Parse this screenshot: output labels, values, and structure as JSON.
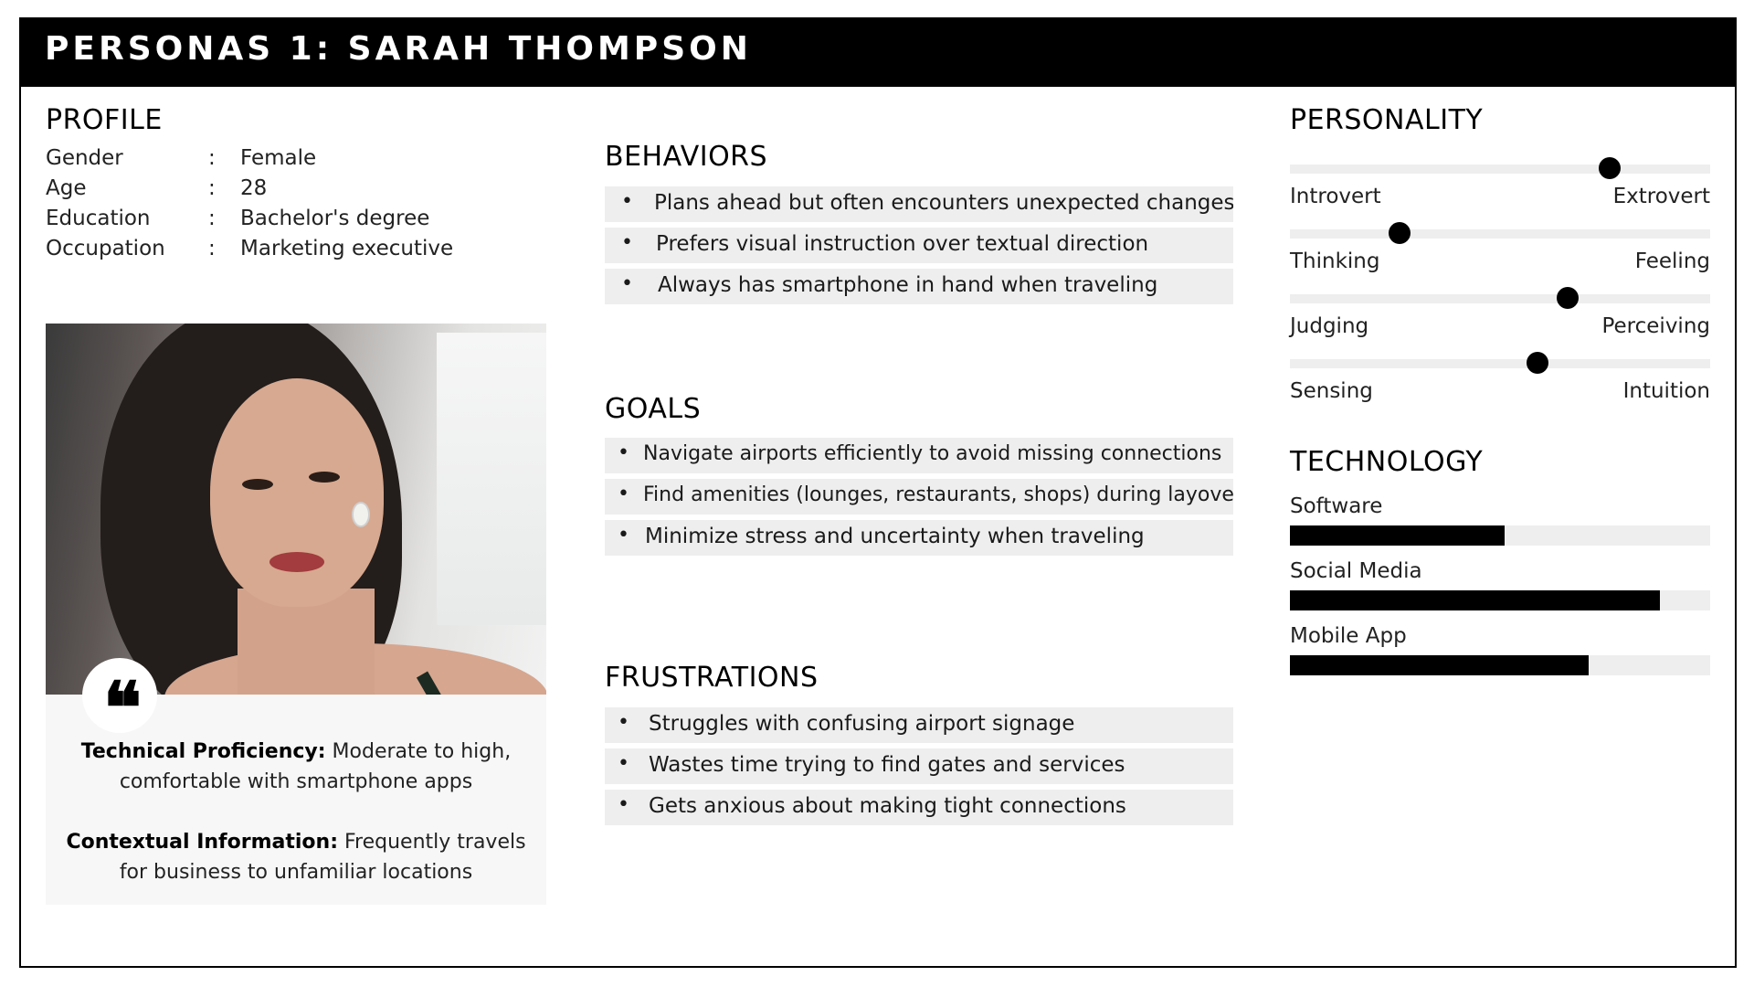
{
  "title": "PERSONAS 1: SARAH THOMPSON",
  "profile": {
    "heading": "PROFILE",
    "rows": [
      {
        "label": "Gender",
        "value": "Female"
      },
      {
        "label": "Age",
        "value": "28"
      },
      {
        "label": "Education",
        "value": "Bachelor's degree"
      },
      {
        "label": "Occupation",
        "value": "Marketing executive"
      }
    ],
    "separator": ":"
  },
  "quote": {
    "icon": "quote-icon",
    "glyph": "❝",
    "items": [
      {
        "label": "Technical Proficiency:",
        "text_line1": " Moderate to high,",
        "text_line2": "comfortable with smartphone apps"
      },
      {
        "label": "Contextual Information:",
        "text_line1": " Frequently travels",
        "text_line2": "for business to unfamiliar locations"
      }
    ]
  },
  "behaviors": {
    "heading": "BEHAVIORS",
    "items": [
      "Plans ahead but often encounters unexpected changes",
      "Prefers visual instruction over textual direction",
      "Always has smartphone in hand when traveling"
    ]
  },
  "goals": {
    "heading": "GOALS",
    "items": [
      "Navigate airports efficiently to avoid missing connections",
      "Find amenities (lounges, restaurants, shops) during layovers",
      "Minimize stress and uncertainty when traveling"
    ]
  },
  "frustrations": {
    "heading": "FRUSTRATIONS",
    "items": [
      "Struggles with confusing airport signage",
      "Wastes time trying to find gates and services",
      "Gets anxious about making tight connections"
    ]
  },
  "personality": {
    "heading": "PERSONALITY",
    "traits": [
      {
        "left": "Introvert",
        "right": "Extrovert",
        "level": 0.76
      },
      {
        "left": "Thinking",
        "right": "Feeling",
        "level": 0.26
      },
      {
        "left": "Judging",
        "right": "Perceiving",
        "level": 0.66
      },
      {
        "left": "Sensing",
        "right": "Intuition",
        "level": 0.59
      }
    ]
  },
  "technology": {
    "heading": "TECHNOLOGY",
    "items": [
      {
        "label": "Software",
        "level": 0.51
      },
      {
        "label": "Social Media",
        "level": 0.88
      },
      {
        "label": "Mobile App",
        "level": 0.71
      }
    ]
  },
  "colors": {
    "header_bg": "#000000",
    "header_text": "#ffffff",
    "list_bg": "#eeeeee",
    "bar_fill": "#000000",
    "track": "#eeeeee"
  }
}
